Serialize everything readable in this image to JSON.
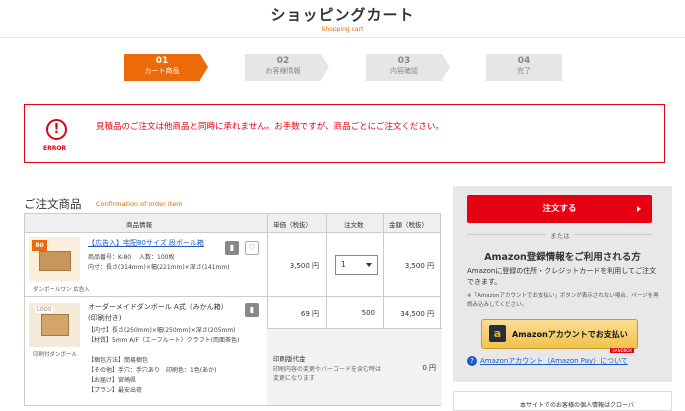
{
  "header": {
    "title": "ショッピングカート",
    "subtitle": "Shopping cart"
  },
  "steps": [
    {
      "num": "01",
      "label": "カート商品"
    },
    {
      "num": "02",
      "label": "お客様情報"
    },
    {
      "num": "03",
      "label": "内容確認"
    },
    {
      "num": "04",
      "label": "完了"
    }
  ],
  "error": {
    "icon_text": "!",
    "label": "ERROR",
    "message": "見積品のご注文は他商品と同時に承れません。お手数ですが、商品ごとにご注文ください。"
  },
  "order": {
    "title": "ご注文商品",
    "subtitle": "Confirmation of order item",
    "headers": {
      "info": "商品情報",
      "unit_price": "単価（税抜）",
      "qty": "注文数",
      "amount": "金額（税抜）"
    },
    "items": [
      {
        "badge": "80",
        "thumb_caption": "ダンボールワン 広告入",
        "name": "【広告入】宅配80サイズ 段ボール箱",
        "meta1": "商品番号：K-80　 入数：100枚",
        "meta2": "内寸：長さ(314mm)×幅(221mm)×深さ(141mm)",
        "price": "3,500 円",
        "qty": "1",
        "amount": "3,500 円"
      },
      {
        "thumb_logo": "LOGO",
        "thumb_caption": "印刷付ダンボール",
        "name": "オーダーメイドダンボール A式（みかん箱）(印刷付き)",
        "spec1": "【内寸】長さ(250mm)×幅(250mm)×深さ(205mm)",
        "spec2": "【材質】5mm A/F（エーフルート）クラフト(両面茶色)",
        "spec3": "【梱包方法】簡易梱包",
        "spec4": "【その他】手穴：手穴あり　印刷色：1色(あか)",
        "spec5": "【お届け】宮崎県",
        "spec6": "【プラン】最安出荷",
        "price": "69 円",
        "qty": "500",
        "amount": "34,500 円",
        "print_label": "印刷版代金",
        "print_note": "印刷内容の変更やバーコードを含む時は変更になります",
        "print_price": "0 円"
      }
    ]
  },
  "sidebar": {
    "checkout_label": "注文する",
    "or_text": "または",
    "amazon_title": "Amazon登録情報をご利用される方",
    "amazon_desc": "Amazonに登録の住所・クレジットカードを利用してご注文できます。",
    "amazon_note": "※「Amazonアカウントでお支払い」ボタンが表示されない場合、ページを再読み込みしてください。",
    "amazon_logo": "a",
    "amazon_btn": "Amazonアカウントでお支払い",
    "sandbox": "SANDBOX",
    "help_icon": "?",
    "help_link": "Amazonアカウント（Amazon Pay）について",
    "footer_text": "本サイトでのお客様の個人情報はクローバ"
  },
  "colors": {
    "accent": "#ec6a0a",
    "error": "#e60012",
    "link": "#1a5bc8"
  }
}
